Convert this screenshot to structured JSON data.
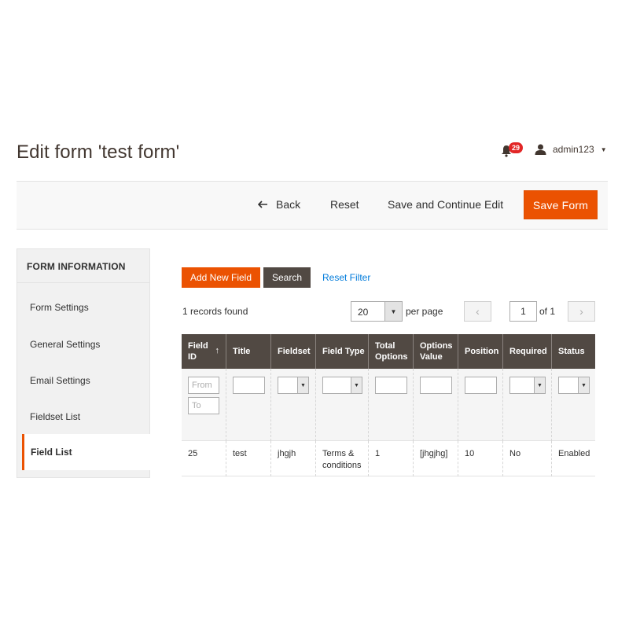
{
  "header": {
    "page_title": "Edit form 'test form'",
    "notification_count": "29",
    "username": "admin123"
  },
  "actions": {
    "back": "Back",
    "reset": "Reset",
    "save_continue": "Save and Continue Edit",
    "save": "Save Form"
  },
  "sidebar": {
    "title": "FORM INFORMATION",
    "items": [
      "Form Settings",
      "General Settings",
      "Email Settings",
      "Fieldset List",
      "Field List"
    ],
    "active_index": 4
  },
  "toolbar": {
    "add_new": "Add New Field",
    "search": "Search",
    "reset_filter": "Reset Filter",
    "records_found": "1 records found",
    "per_page_value": "20",
    "per_page_label": "per page",
    "current_page": "1",
    "of_pages": "of 1"
  },
  "grid": {
    "columns": [
      "Field ID",
      "Title",
      "Fieldset",
      "Field Type",
      "Total Options",
      "Options Value",
      "Position",
      "Required",
      "Status"
    ],
    "column_lines": [
      [
        "Field",
        "ID"
      ],
      [
        "Title"
      ],
      [
        "Fieldset"
      ],
      [
        "Field Type"
      ],
      [
        "Total",
        "Options"
      ],
      [
        "Options",
        "Value"
      ],
      [
        "Position"
      ],
      [
        "Required"
      ],
      [
        "Status"
      ]
    ],
    "filters": {
      "from_placeholder": "From",
      "to_placeholder": "To"
    },
    "rows": [
      [
        "25",
        "test",
        "jhgjh",
        "Terms & conditions",
        "1",
        "[jhgjhg]",
        "10",
        "No",
        "Enabled"
      ]
    ]
  },
  "colors": {
    "accent": "#eb5202",
    "grid_header": "#514943",
    "link": "#007bdb"
  }
}
